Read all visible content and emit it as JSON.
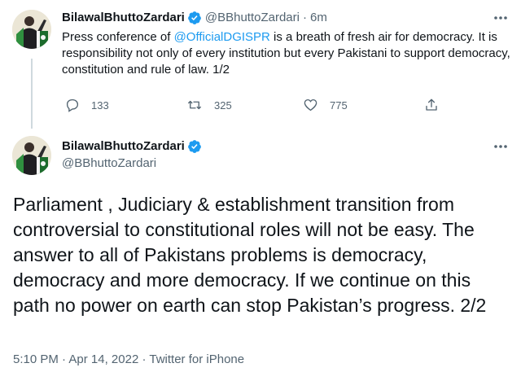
{
  "tweet1": {
    "display_name": "BilawalBhuttoZardari",
    "handle": "@BBhuttoZardari",
    "separator": "·",
    "time": "6m",
    "text_before": "Press conference of ",
    "mention": "@OfficialDGISPR",
    "text_after": " is a breath of fresh air for democracy. It is responsibility not only of every institution but every Pakistani to support democracy, constitution and rule of law. 1/2",
    "replies": "133",
    "retweets": "325",
    "likes": "775",
    "icons": {
      "reply": "reply-icon",
      "retweet": "retweet-icon",
      "like": "heart-icon",
      "share": "share-icon",
      "more": "more-icon",
      "verified": "verified-badge-icon"
    }
  },
  "tweet2": {
    "display_name": "BilawalBhuttoZardari",
    "handle": "@BBhuttoZardari",
    "text": "Parliament , Judiciary & establishment transition from controversial to constitutional roles will not be easy. The answer to all of Pakistans problems is democracy, democracy and more democracy. If we continue on this path no power on earth can stop Pakistan’s progress. 2/2",
    "time": "5:10 PM",
    "separator1": "·",
    "date": "Apr 14, 2022",
    "separator2": "·",
    "source": "Twitter for iPhone"
  },
  "colors": {
    "text": "#0f1419",
    "secondary": "#536471",
    "accent": "#1d9bf0",
    "thread_line": "#cfd9de"
  }
}
